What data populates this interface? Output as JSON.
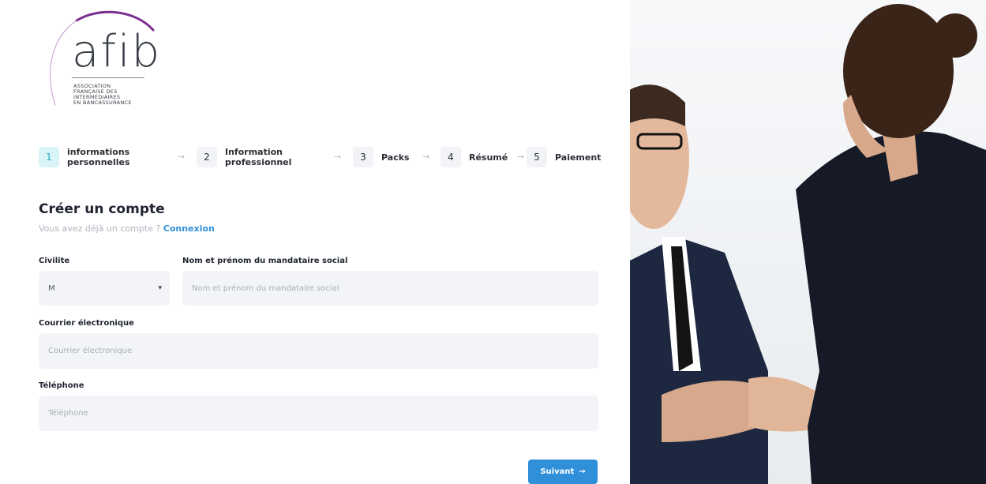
{
  "logo": {
    "word": "afib",
    "tagline": [
      "ASSOCIATION",
      "FRANÇAISE DES",
      "INTERMÉDIAIRES",
      "EN BANCASSURANCE"
    ]
  },
  "steps": [
    {
      "number": "1",
      "label_line1": "informations",
      "label_line2": "personnelles",
      "active": true
    },
    {
      "number": "2",
      "label_line1": "Information",
      "label_line2": "professionnel",
      "active": false
    },
    {
      "number": "3",
      "label_line1": "Packs",
      "label_line2": "",
      "active": false
    },
    {
      "number": "4",
      "label_line1": "Résumé",
      "label_line2": "",
      "active": false
    },
    {
      "number": "5",
      "label_line1": "Paiement",
      "label_line2": "",
      "active": false
    }
  ],
  "step_arrow": "→",
  "heading": {
    "title": "Créer un compte",
    "subtitle": "Vous avez déjà un compte ?",
    "login_link": "Connexion"
  },
  "form": {
    "civility_label": "Civilite",
    "civility_value": "M",
    "mandataire_label": "Nom et prénom du mandataire social",
    "mandataire_placeholder": "Nom et prénom du mandataire social",
    "email_label": "Courrier électronique",
    "email_placeholder": "Courrier électronique",
    "phone_label": "Téléphone",
    "phone_placeholder": "Téléphone",
    "submit_label": "Suivant",
    "submit_arrow": "→"
  },
  "colors": {
    "accent_blue": "#2f8fd8",
    "active_step_bg": "#d8f4f7",
    "logo_purple": "#7b2f8f"
  }
}
